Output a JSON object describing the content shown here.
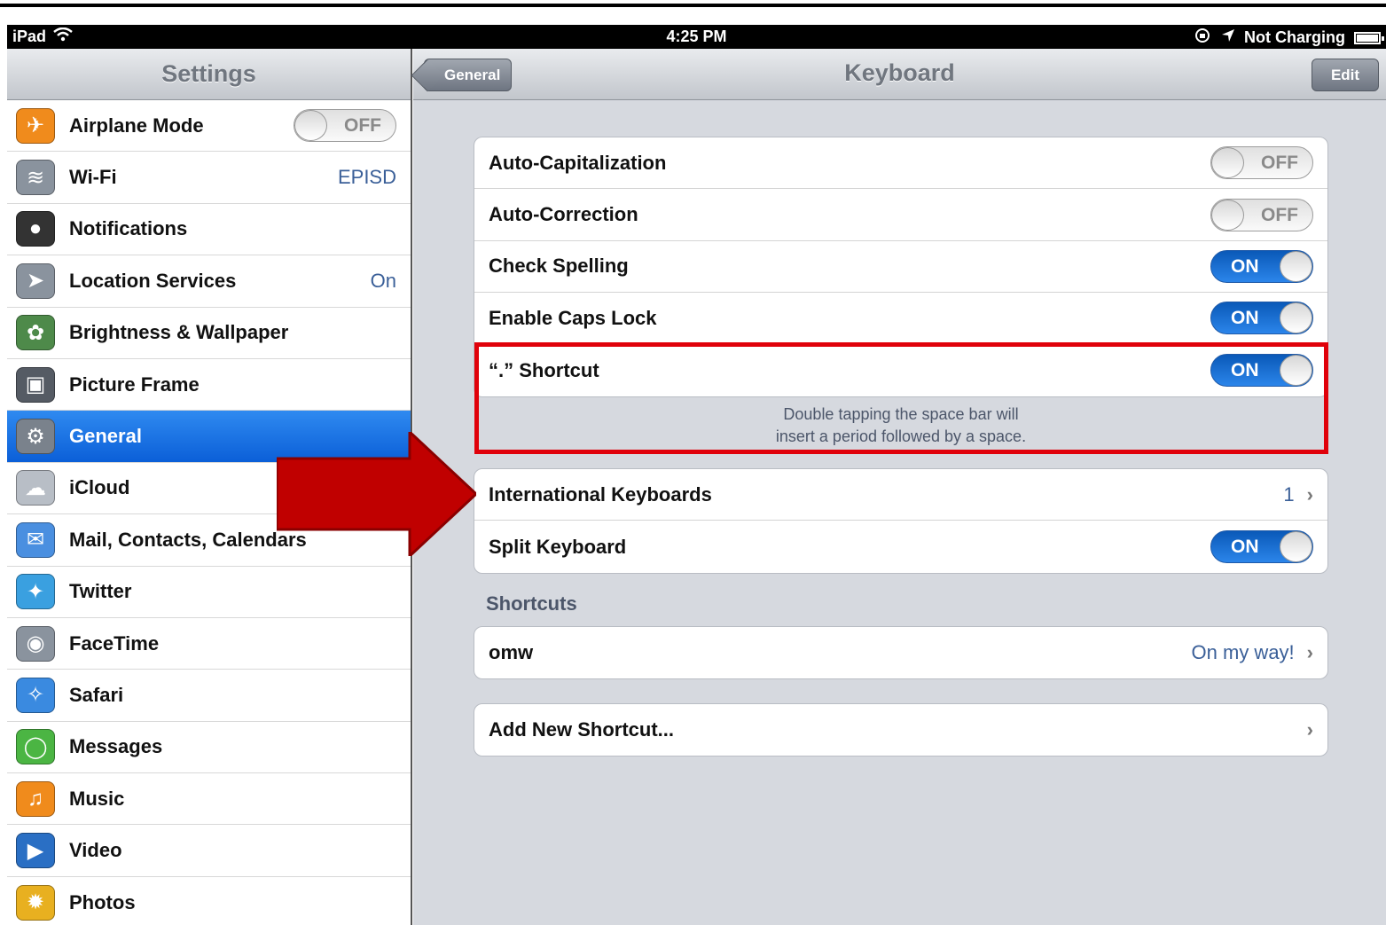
{
  "status_bar": {
    "device": "iPad",
    "time": "4:25 PM",
    "charging": "Not Charging",
    "battery_level": 1.0
  },
  "sidebar": {
    "title": "Settings",
    "items": [
      {
        "label": "Airplane Mode",
        "icon": "airplane-icon",
        "icon_glyph": "✈",
        "icon_color": "#f08b1c",
        "toggle": "OFF"
      },
      {
        "label": "Wi-Fi",
        "icon": "wifi-icon",
        "icon_glyph": "≋",
        "icon_color": "#8a939e",
        "value": "EPISD"
      },
      {
        "label": "Notifications",
        "icon": "notifications-icon",
        "icon_glyph": "●",
        "icon_color": "#333333"
      },
      {
        "label": "Location Services",
        "icon": "location-icon",
        "icon_glyph": "➤",
        "icon_color": "#8a939e",
        "value": "On"
      },
      {
        "label": "Brightness & Wallpaper",
        "icon": "brightness-icon",
        "icon_glyph": "✿",
        "icon_color": "#4e8a4a"
      },
      {
        "label": "Picture Frame",
        "icon": "picture-frame-icon",
        "icon_glyph": "▣",
        "icon_color": "#555b64"
      },
      {
        "label": "General",
        "icon": "gear-icon",
        "icon_glyph": "⚙",
        "icon_color": "#7a828c",
        "selected": true
      },
      {
        "label": "iCloud",
        "icon": "cloud-icon",
        "icon_glyph": "☁",
        "icon_color": "#b8bec6"
      },
      {
        "label": "Mail, Contacts, Calendars",
        "icon": "mail-icon",
        "icon_glyph": "✉",
        "icon_color": "#4a8fe0"
      },
      {
        "label": "Twitter",
        "icon": "twitter-icon",
        "icon_glyph": "✦",
        "icon_color": "#3aa0e0"
      },
      {
        "label": "FaceTime",
        "icon": "facetime-icon",
        "icon_glyph": "◉",
        "icon_color": "#8a939e"
      },
      {
        "label": "Safari",
        "icon": "safari-icon",
        "icon_glyph": "✧",
        "icon_color": "#3a8ae0"
      },
      {
        "label": "Messages",
        "icon": "messages-icon",
        "icon_glyph": "◯",
        "icon_color": "#4bb543"
      },
      {
        "label": "Music",
        "icon": "music-icon",
        "icon_glyph": "♫",
        "icon_color": "#f08b1c"
      },
      {
        "label": "Video",
        "icon": "video-icon",
        "icon_glyph": "▶",
        "icon_color": "#2a6fc4"
      },
      {
        "label": "Photos",
        "icon": "photos-icon",
        "icon_glyph": "✹",
        "icon_color": "#e8b020"
      }
    ]
  },
  "main": {
    "title": "Keyboard",
    "back_label": "General",
    "edit_label": "Edit",
    "group1": [
      {
        "label": "Auto-Capitalization",
        "toggle": "OFF"
      },
      {
        "label": "Auto-Correction",
        "toggle": "OFF"
      },
      {
        "label": "Check Spelling",
        "toggle": "ON"
      },
      {
        "label": "Enable Caps Lock",
        "toggle": "ON"
      },
      {
        "label": "“.” Shortcut",
        "toggle": "ON"
      }
    ],
    "shortcut_note_line1": "Double tapping the space bar will",
    "shortcut_note_line2": "insert a period followed by a space.",
    "group2": [
      {
        "label": "International Keyboards",
        "value": "1"
      },
      {
        "label": "Split Keyboard",
        "toggle": "ON"
      }
    ],
    "shortcuts_header": "Shortcuts",
    "shortcut_row": {
      "label": "omw",
      "value": "On my way!"
    },
    "add_shortcut": {
      "label": "Add New Shortcut..."
    }
  },
  "colors": {
    "highlight": "#e0010a",
    "arrow": "#c00000",
    "selected_row": "#0b5fd8"
  }
}
